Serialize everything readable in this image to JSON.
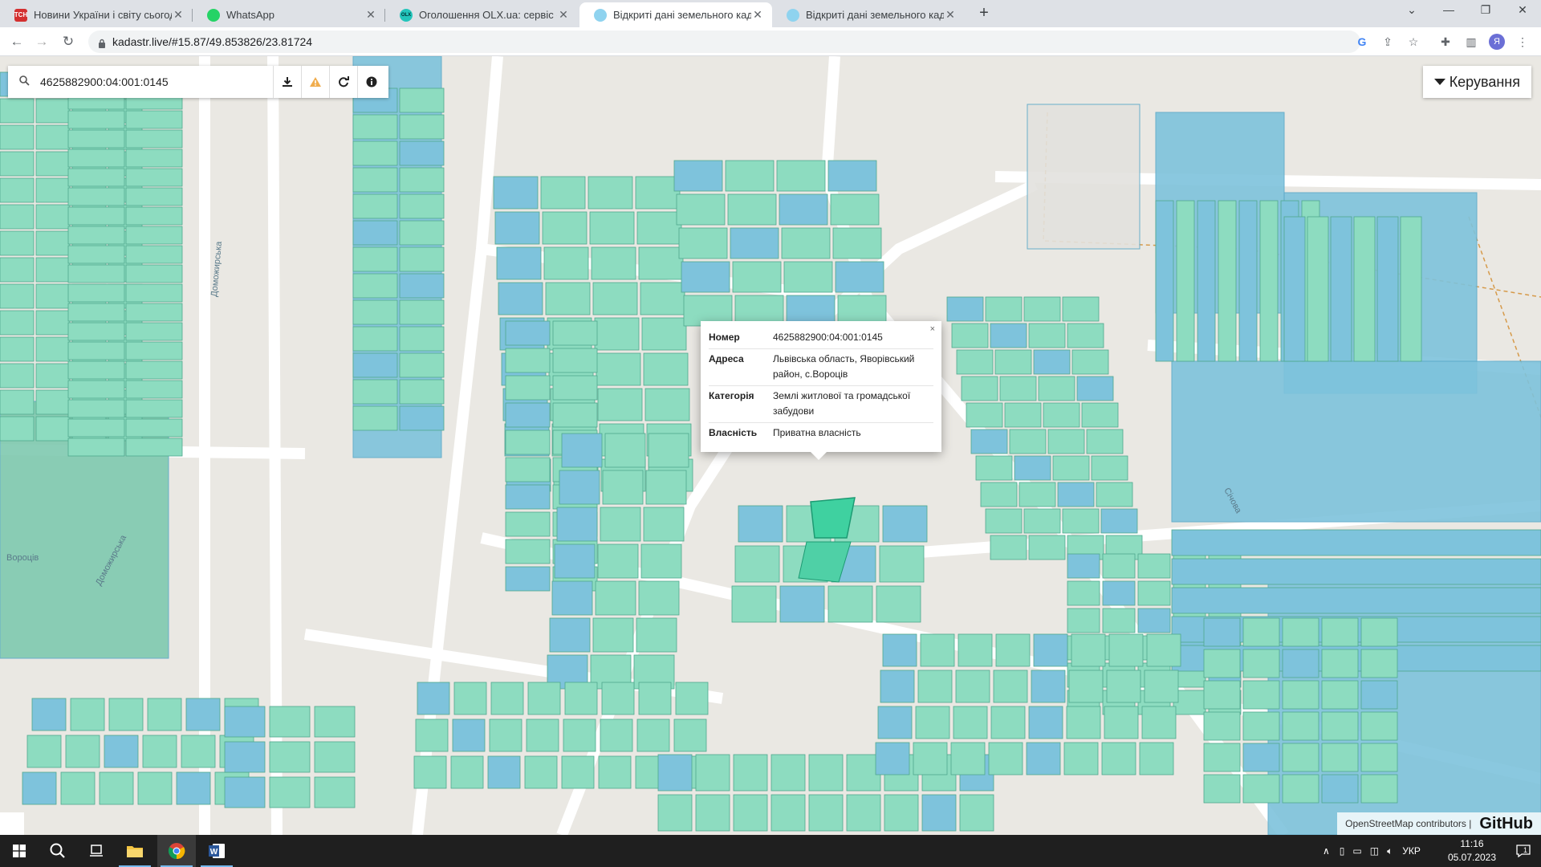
{
  "browser": {
    "tabs": [
      {
        "title": "Новини України і світу сьогодні",
        "icon": "tsn-favicon",
        "color": "#d32f2f",
        "mark": "ТСН"
      },
      {
        "title": "WhatsApp",
        "icon": "whatsapp-favicon",
        "color": "#25d366",
        "mark": ""
      },
      {
        "title": "Оголошення OLX.ua: сервіс оголошень",
        "icon": "olx-favicon",
        "color": "#23e5db",
        "mark": "OLX"
      },
      {
        "title": "Відкриті дані земельного кадастру",
        "icon": "kadastr-favicon",
        "color": "#5bc0de",
        "mark": ""
      },
      {
        "title": "Відкриті дані земельного кадастру",
        "icon": "kadastr-favicon",
        "color": "#5bc0de",
        "mark": ""
      }
    ],
    "active_tab": 3,
    "new_tab": "+",
    "url": "kadastr.live/#15.87/49.853826/23.81724",
    "profile_letter": "Я"
  },
  "map_ui": {
    "search_value": "4625882900:04:001:0145",
    "controls_label": "Керування",
    "popup": {
      "close": "×",
      "rows": [
        {
          "key": "Номер",
          "value": "4625882900:04:001:0145"
        },
        {
          "key": "Адреса",
          "value": "Львівська область, Яворівський район, с.Вороців"
        },
        {
          "key": "Категорія",
          "value": "Землі житлової та громадської забудови"
        },
        {
          "key": "Власність",
          "value": "Приватна власність"
        }
      ]
    },
    "attribution": "OpenStreetMap contributors |",
    "github": "GitHub",
    "street_labels": [
      "Доможирська",
      "Доможирська",
      "Січова",
      "Вороців"
    ]
  },
  "colors": {
    "parcel_green": "#8ddcc0",
    "parcel_blue": "#7ec3dc",
    "road": "#ffffff",
    "background": "#eae8e3",
    "highlight": "#3fd1a0"
  },
  "taskbar": {
    "language": "УКР",
    "time": "11:16",
    "date": "05.07.2023",
    "notifications": "1"
  }
}
